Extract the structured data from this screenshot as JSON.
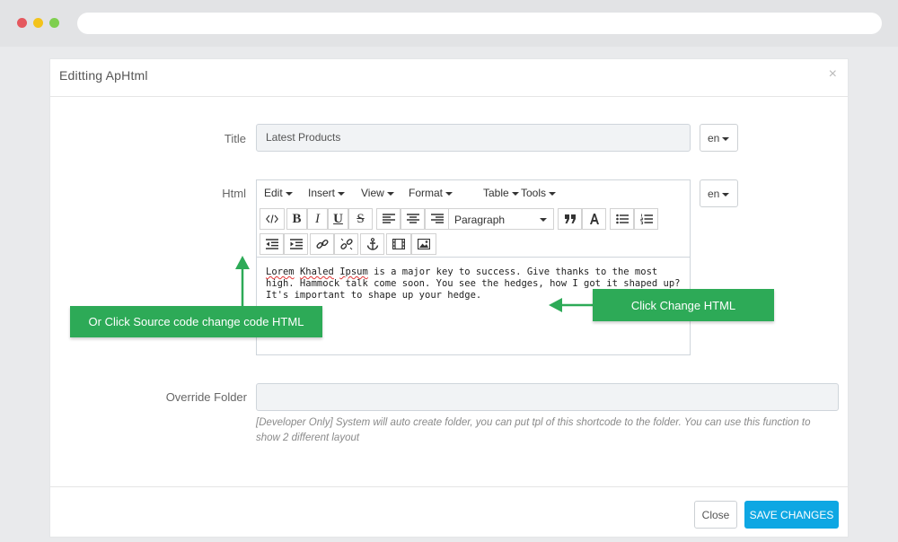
{
  "modal": {
    "title": "Editting ApHtml",
    "close_symbol": "×"
  },
  "form": {
    "title_label": "Title",
    "title_value": "Latest Products",
    "title_lang": "en",
    "html_label": "Html",
    "html_lang": "en",
    "override_label": "Override Folder",
    "override_value": "",
    "help_text": "[Developer Only] System will auto create folder, you can put tpl of this shortcode to the folder. You can use this function to show 2 different layout"
  },
  "editor": {
    "menus": [
      "Edit",
      "Insert",
      "View",
      "Format",
      "Table",
      "Tools"
    ],
    "toolbar_icons": [
      "source-code-icon",
      "bold-icon",
      "italic-icon",
      "underline-icon",
      "strikethrough-icon",
      "align-left-icon",
      "align-center-icon",
      "align-right-icon",
      "blockquote-icon",
      "text-color-icon",
      "bullet-list-icon",
      "numbered-list-icon",
      "outdent-icon",
      "indent-icon",
      "link-icon",
      "unlink-icon",
      "anchor-icon",
      "media-icon",
      "image-icon"
    ],
    "format_value": "Paragraph",
    "content_spell1": "Lorem",
    "content_spell2": "Khaled",
    "content_spell3": "Ipsum",
    "content_rest": " is a major key to success. Give thanks to the most high. Hammock talk come soon. You see the hedges, how I got it shaped up? It's important to shape up your hedge."
  },
  "footer": {
    "close_label": "Close",
    "save_label": "SAVE CHANGES"
  },
  "annotations": {
    "source_callout": "Or Click Source code change code HTML",
    "change_callout": "Click Change HTML",
    "accent_color": "#2daa57"
  }
}
